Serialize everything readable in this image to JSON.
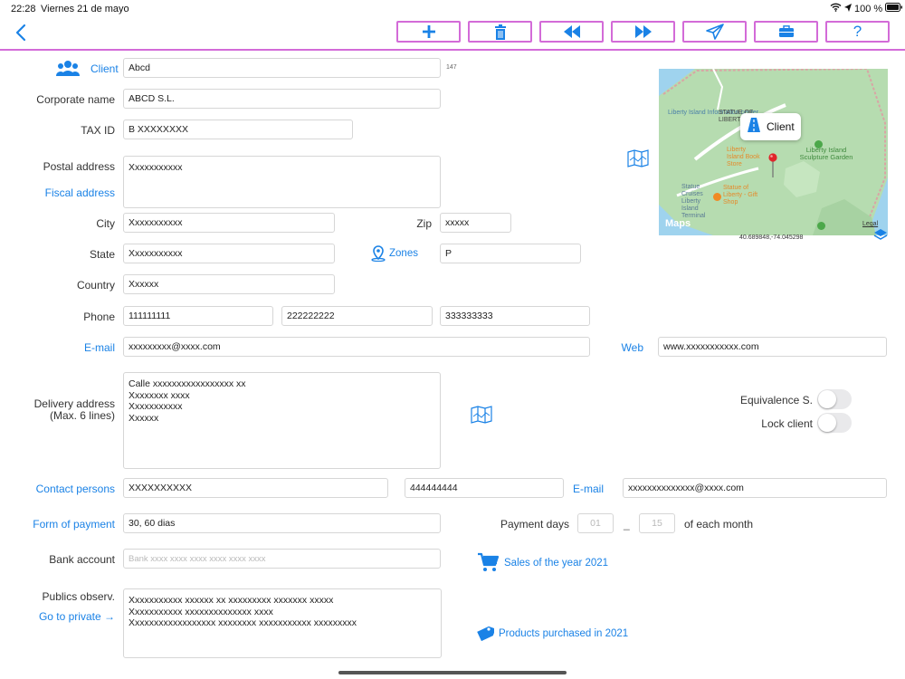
{
  "status_bar": {
    "time": "22:28",
    "date": "Viernes 21 de mayo",
    "battery": "100 %"
  },
  "toolbar": {
    "back_icon": "chevron-left-icon",
    "buttons": [
      {
        "name": "add",
        "icon": "plus-icon"
      },
      {
        "name": "delete",
        "icon": "trash-icon"
      },
      {
        "name": "previous",
        "icon": "rewind-icon"
      },
      {
        "name": "next",
        "icon": "fast-forward-icon"
      },
      {
        "name": "send",
        "icon": "paper-plane-icon"
      },
      {
        "name": "briefcase",
        "icon": "briefcase-icon"
      },
      {
        "name": "help",
        "icon": "question-icon",
        "label": "?"
      }
    ],
    "accent": "#d36bd8"
  },
  "form": {
    "client_label": "Client",
    "client_value": "Abcd",
    "client_number": "147",
    "corporate_label": "Corporate name",
    "corporate_value": "ABCD S.L.",
    "tax_label": "TAX ID",
    "tax_value": "B XXXXXXXX",
    "postal_label": "Postal address",
    "postal_value": "Xxxxxxxxxxx",
    "fiscal_label": "Fiscal address",
    "city_label": "City",
    "city_value": "Xxxxxxxxxxx",
    "zip_label": "Zip",
    "zip_value": "xxxxx",
    "state_label": "State",
    "state_value": "Xxxxxxxxxxx",
    "zones_label": "Zones",
    "zones_value": "P",
    "country_label": "Country",
    "country_value": "Xxxxxx",
    "phone_label": "Phone",
    "phone1": "111111111",
    "phone2": "222222222",
    "phone3": "333333333",
    "email_label": "E-mail",
    "email_value": "xxxxxxxxx@xxxx.com",
    "web_label": "Web",
    "web_value": "www.xxxxxxxxxxx.com",
    "delivery_label_1": "Delivery address",
    "delivery_label_2": "(Max. 6 lines)",
    "delivery_value": "Calle xxxxxxxxxxxxxxxxx xx\nXxxxxxxx xxxx\nXxxxxxxxxxx\nXxxxxx",
    "equivalence_label": "Equivalence S.",
    "lock_label": "Lock client",
    "contact_label": "Contact persons",
    "contact_name": "XXXXXXXXXX",
    "contact_phone": "444444444",
    "contact_email_label": "E-mail",
    "contact_email": "xxxxxxxxxxxxxx@xxxx.com",
    "payment_form_label": "Form of payment",
    "payment_form_value": "30, 60 dias",
    "payment_days_label": "Payment days",
    "payment_day1_placeholder": "01",
    "payment_day2_placeholder": "15",
    "payment_days_sep": "_",
    "of_each_month": "of each month",
    "bank_label": "Bank account",
    "bank_placeholder": "Bank xxxx xxxx xxxx xxxx xxxx xxxx",
    "sales_label": "Sales of the year 2021",
    "observ_label": "Publics observ.",
    "go_private": "Go to private →",
    "observ_value": "Xxxxxxxxxxx xxxxxx xx xxxxxxxxx xxxxxxx xxxxx\nXxxxxxxxxxx xxxxxxxxxxxxxx xxxx\nXxxxxxxxxxxxxxxxxx xxxxxxxx xxxxxxxxxxx xxxxxxxxx",
    "products_label": "Products purchased in 2021"
  },
  "map": {
    "pin_label": "Client",
    "coordinates": "40.689848,-74.045298",
    "place_labels": [
      "Liberty Island Sculpture Garden",
      "Liberty Island Book Store",
      "Statue of Liberty - Gift Shop",
      "Statue Cruises Liberty Island Terminal",
      "Liberty Island Information center",
      "STATUE OF LIBERTY"
    ],
    "logo": "Maps",
    "legal": "Legal"
  },
  "colors": {
    "link": "#1a82e6",
    "accent": "#d36bd8",
    "water": "#9fd3ee",
    "land": "#b6dcb0"
  }
}
